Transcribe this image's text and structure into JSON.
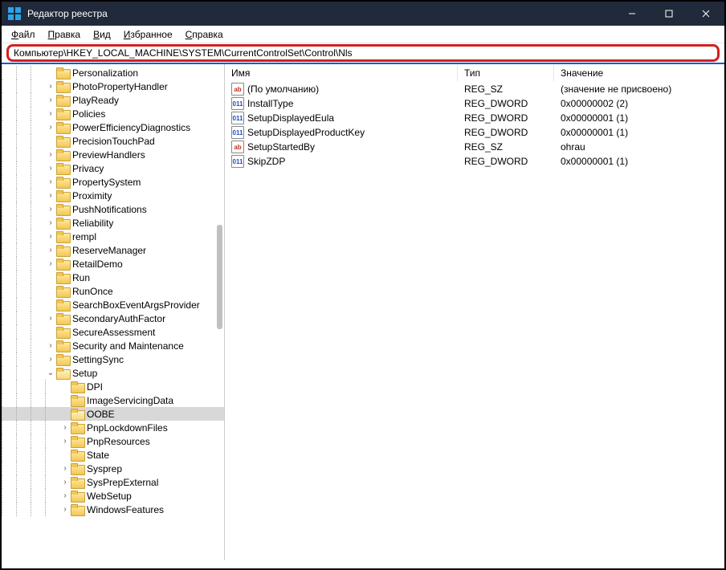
{
  "window": {
    "title": "Редактор реестра"
  },
  "menu": {
    "file": "Файл",
    "edit": "Правка",
    "view": "Вид",
    "favorites": "Избранное",
    "help": "Справка"
  },
  "address": "Компьютер\\HKEY_LOCAL_MACHINE\\SYSTEM\\CurrentControlSet\\Control\\Nls",
  "columns": {
    "name": "Имя",
    "type": "Тип",
    "data": "Значение"
  },
  "tree": [
    {
      "level": 3,
      "twisty": "",
      "label": "Personalization"
    },
    {
      "level": 3,
      "twisty": ">",
      "label": "PhotoPropertyHandler"
    },
    {
      "level": 3,
      "twisty": ">",
      "label": "PlayReady"
    },
    {
      "level": 3,
      "twisty": ">",
      "label": "Policies"
    },
    {
      "level": 3,
      "twisty": ">",
      "label": "PowerEfficiencyDiagnostics"
    },
    {
      "level": 3,
      "twisty": "",
      "label": "PrecisionTouchPad"
    },
    {
      "level": 3,
      "twisty": ">",
      "label": "PreviewHandlers"
    },
    {
      "level": 3,
      "twisty": ">",
      "label": "Privacy"
    },
    {
      "level": 3,
      "twisty": ">",
      "label": "PropertySystem"
    },
    {
      "level": 3,
      "twisty": ">",
      "label": "Proximity"
    },
    {
      "level": 3,
      "twisty": ">",
      "label": "PushNotifications"
    },
    {
      "level": 3,
      "twisty": ">",
      "label": "Reliability"
    },
    {
      "level": 3,
      "twisty": ">",
      "label": "rempl"
    },
    {
      "level": 3,
      "twisty": ">",
      "label": "ReserveManager"
    },
    {
      "level": 3,
      "twisty": ">",
      "label": "RetailDemo"
    },
    {
      "level": 3,
      "twisty": "",
      "label": "Run"
    },
    {
      "level": 3,
      "twisty": "",
      "label": "RunOnce"
    },
    {
      "level": 3,
      "twisty": "",
      "label": "SearchBoxEventArgsProvider"
    },
    {
      "level": 3,
      "twisty": ">",
      "label": "SecondaryAuthFactor"
    },
    {
      "level": 3,
      "twisty": "",
      "label": "SecureAssessment"
    },
    {
      "level": 3,
      "twisty": ">",
      "label": "Security and Maintenance"
    },
    {
      "level": 3,
      "twisty": ">",
      "label": "SettingSync"
    },
    {
      "level": 3,
      "twisty": "v",
      "label": "Setup",
      "expanded": true
    },
    {
      "level": 4,
      "twisty": "",
      "label": "DPI"
    },
    {
      "level": 4,
      "twisty": "",
      "label": "ImageServicingData"
    },
    {
      "level": 4,
      "twisty": "",
      "label": "OOBE",
      "selected": true
    },
    {
      "level": 4,
      "twisty": ">",
      "label": "PnpLockdownFiles"
    },
    {
      "level": 4,
      "twisty": ">",
      "label": "PnpResources"
    },
    {
      "level": 4,
      "twisty": "",
      "label": "State"
    },
    {
      "level": 4,
      "twisty": ">",
      "label": "Sysprep"
    },
    {
      "level": 4,
      "twisty": ">",
      "label": "SysPrepExternal"
    },
    {
      "level": 4,
      "twisty": ">",
      "label": "WebSetup"
    },
    {
      "level": 4,
      "twisty": ">",
      "label": "WindowsFeatures",
      "cut": true
    }
  ],
  "values": [
    {
      "icon": "sz",
      "name": "(По умолчанию)",
      "type": "REG_SZ",
      "data": "(значение не присвоено)"
    },
    {
      "icon": "dw",
      "name": "InstallType",
      "type": "REG_DWORD",
      "data": "0x00000002 (2)"
    },
    {
      "icon": "dw",
      "name": "SetupDisplayedEula",
      "type": "REG_DWORD",
      "data": "0x00000001 (1)"
    },
    {
      "icon": "dw",
      "name": "SetupDisplayedProductKey",
      "type": "REG_DWORD",
      "data": "0x00000001 (1)"
    },
    {
      "icon": "sz",
      "name": "SetupStartedBy",
      "type": "REG_SZ",
      "data": "ohrau"
    },
    {
      "icon": "dw",
      "name": "SkipZDP",
      "type": "REG_DWORD",
      "data": "0x00000001 (1)"
    }
  ]
}
